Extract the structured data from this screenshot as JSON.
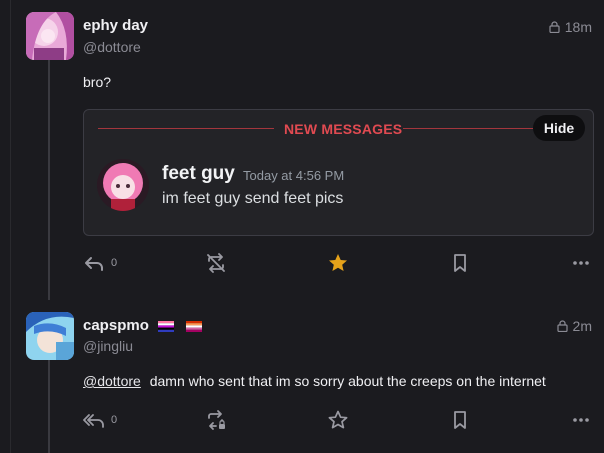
{
  "posts": [
    {
      "display_name": "ephy day",
      "handle": "@dottore",
      "time": "18m",
      "text": "bro?",
      "actions": {
        "reply_count": "0"
      }
    },
    {
      "display_name": "capspmo",
      "handle": "@jingliu",
      "time": "2m",
      "mention": "@dottore",
      "text": "damn who sent that im so sorry about the creeps on the internet",
      "actions": {
        "reply_count": "0"
      }
    }
  ],
  "embed": {
    "divider_label": "NEW MESSAGES",
    "hide_label": "Hide",
    "author": "feet guy",
    "timestamp": "Today at 4:56 PM",
    "message": "im feet guy send feet pics"
  },
  "colors": {
    "accent_star": "#e5a21a",
    "new_messages_red": "#e04a51",
    "muted": "#8b8b94"
  },
  "icons": [
    "reply-icon",
    "reply-all-icon",
    "repost-disabled-icon",
    "repost-locked-icon",
    "star-icon",
    "bookmark-icon",
    "more-icon",
    "lock-icon"
  ]
}
